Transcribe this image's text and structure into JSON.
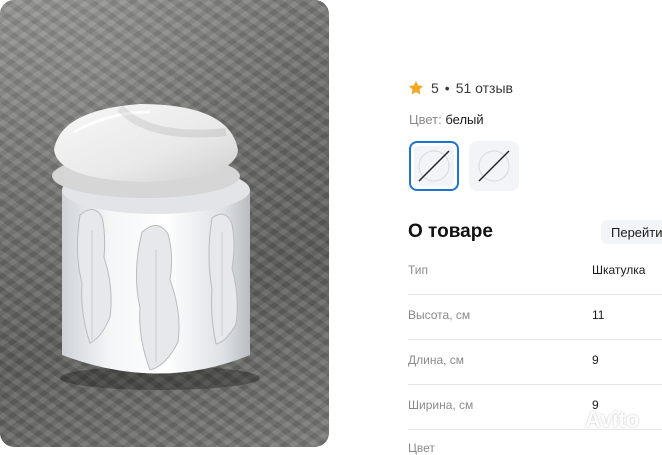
{
  "rating": {
    "score": "5",
    "separator": "•",
    "reviews": "51 отзыв"
  },
  "color": {
    "label": "Цвет:",
    "value": "белый"
  },
  "about": {
    "title": "О товаре",
    "goto_button": "Перейти"
  },
  "specs": [
    {
      "key": "Тип",
      "value": "Шкатулка"
    },
    {
      "key": "Высота, см",
      "value": "11"
    },
    {
      "key": "Длина, см",
      "value": "9"
    },
    {
      "key": "Ширина, см",
      "value": "9"
    },
    {
      "key": "Цвет",
      "value": ""
    }
  ],
  "watermark": "Avito",
  "colors": {
    "accent": "#1e74d6",
    "star": "#f5a623",
    "chip_bg": "#f2f4f7"
  }
}
